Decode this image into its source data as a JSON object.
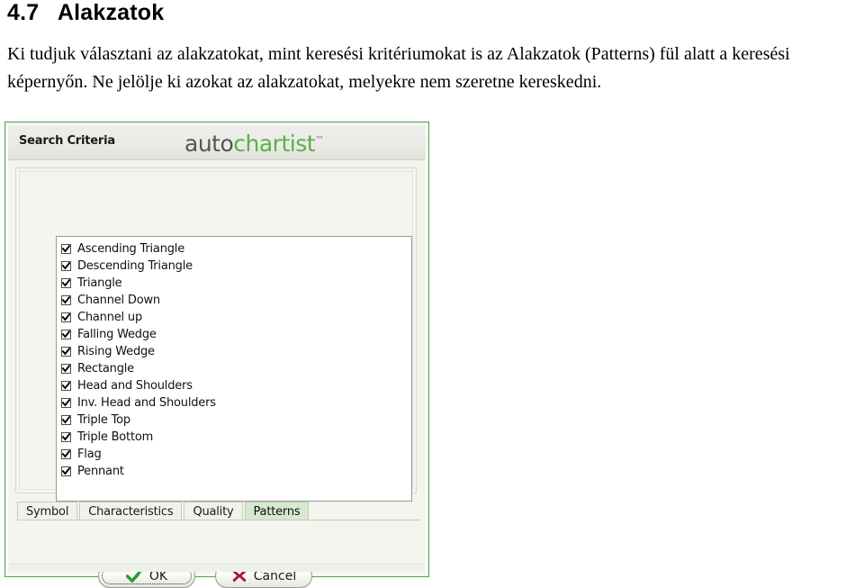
{
  "document": {
    "heading": "4.7   Alakzatok",
    "paragraph": "Ki tudjuk választani az alakzatokat, mint keresési kritériumokat is az Alakzatok (Patterns) fül alatt a keresési képernyőn. Ne jelölje ki azokat az alakzatokat, melyekre nem szeretne kereskedni."
  },
  "dialog": {
    "header": {
      "title": "Search Criteria",
      "logo_part1": "auto",
      "logo_part2": "chartist",
      "logo_tm": "™"
    },
    "patterns": [
      {
        "label": "Ascending Triangle",
        "checked": true
      },
      {
        "label": "Descending Triangle",
        "checked": true
      },
      {
        "label": "Triangle",
        "checked": true
      },
      {
        "label": "Channel Down",
        "checked": true
      },
      {
        "label": "Channel up",
        "checked": true
      },
      {
        "label": "Falling Wedge",
        "checked": true
      },
      {
        "label": "Rising Wedge",
        "checked": true
      },
      {
        "label": "Rectangle",
        "checked": true
      },
      {
        "label": "Head and Shoulders",
        "checked": true
      },
      {
        "label": "Inv. Head and Shoulders",
        "checked": true
      },
      {
        "label": "Triple Top",
        "checked": true
      },
      {
        "label": "Triple Bottom",
        "checked": true
      },
      {
        "label": "Flag",
        "checked": true
      },
      {
        "label": "Pennant",
        "checked": true
      }
    ],
    "tabs": [
      {
        "label": "Symbol",
        "active": false
      },
      {
        "label": "Characteristics",
        "active": false
      },
      {
        "label": "Quality",
        "active": false
      },
      {
        "label": "Patterns",
        "active": true
      }
    ],
    "buttons": {
      "ok": "OK",
      "cancel": "Cancel"
    }
  },
  "colors": {
    "dialog_border_green": "#4aa84a",
    "logo_green": "#5bb04a",
    "logo_gray": "#555555",
    "active_tab_green": "#d6e8cd",
    "ok_check_green": "#2e9b3a",
    "cancel_x_red": "#9e1b25"
  }
}
